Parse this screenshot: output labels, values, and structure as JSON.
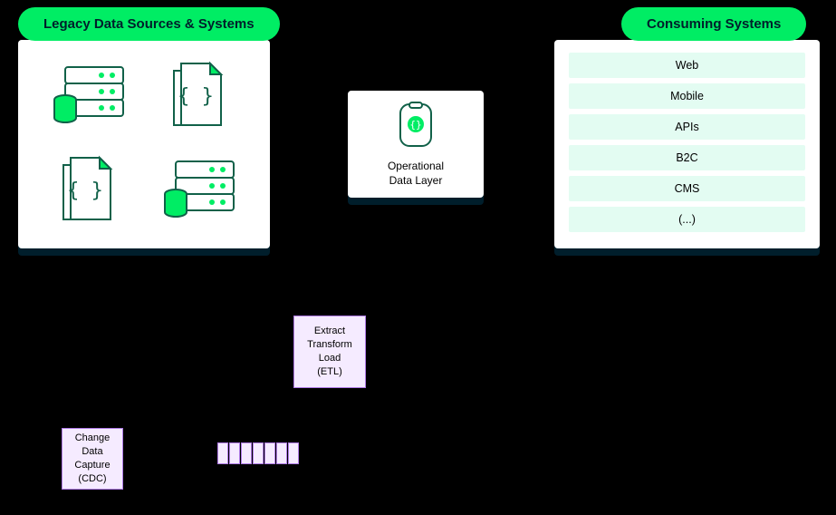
{
  "legacy": {
    "title": "Legacy Data Sources & Systems"
  },
  "consuming": {
    "title": "Consuming Systems",
    "items": [
      "Web",
      "Mobile",
      "APIs",
      "B2C",
      "CMS",
      "(...)"
    ]
  },
  "odl": {
    "label_line1": "Operational",
    "label_line2": "Data Layer"
  },
  "etl": {
    "line1": "Extract",
    "line2": "Transform",
    "line3": "Load",
    "line4": "(ETL)"
  },
  "cdc": {
    "line1": "Change",
    "line2": "Data",
    "line3": "Capture",
    "line4": "(CDC)"
  },
  "colors": {
    "brand_green": "#00ED64",
    "dark_navy": "#001E2B",
    "mint": "#E3FCF2",
    "lilac_fill": "#F5EBFF",
    "lilac_border": "#B07CE8",
    "teal_stroke": "#00684A"
  }
}
